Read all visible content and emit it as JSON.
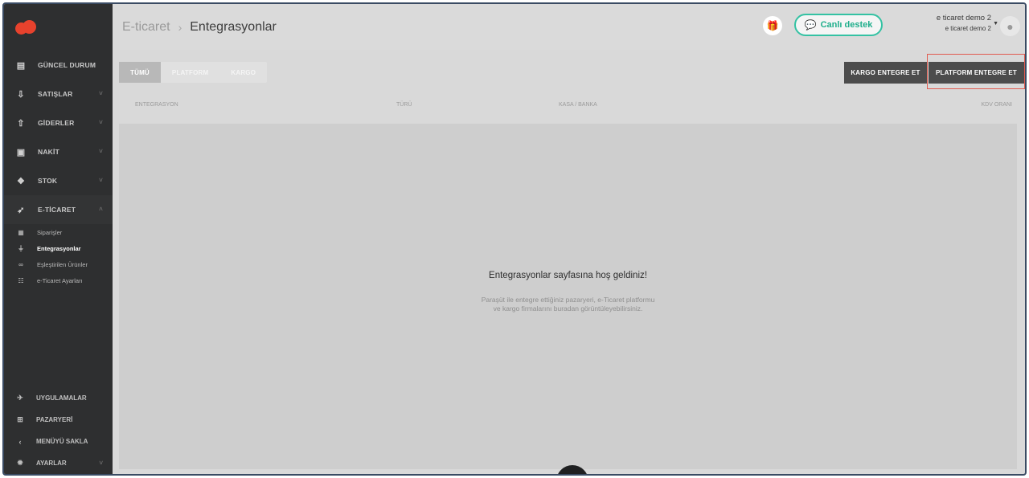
{
  "breadcrumb": {
    "parent": "E-ticaret",
    "separator": "›",
    "current": "Entegrasyonlar"
  },
  "support": {
    "label": "Canlı destek",
    "icon": "chat-bubbles-icon"
  },
  "user": {
    "name": "e ticaret demo 2",
    "company": "e ticaret demo 2"
  },
  "sidebar": {
    "items": [
      {
        "label": "GÜNCEL DURUM",
        "icon": "dashboard-icon"
      },
      {
        "label": "SATIŞLAR",
        "icon": "sales-icon",
        "chevron": "˅"
      },
      {
        "label": "GİDERLER",
        "icon": "expenses-icon",
        "chevron": "˅"
      },
      {
        "label": "NAKİT",
        "icon": "cash-icon",
        "chevron": "˅"
      },
      {
        "label": "STOK",
        "icon": "stock-icon",
        "chevron": "˅"
      },
      {
        "label": "E-TİCARET",
        "icon": "rocket-icon",
        "chevron": "˄"
      }
    ],
    "subitems": [
      {
        "label": "Siparişler",
        "icon": "orders-icon"
      },
      {
        "label": "Entegrasyonlar",
        "icon": "plug-icon",
        "active": true
      },
      {
        "label": "Eşleştirilen Ürünler",
        "icon": "link-icon"
      },
      {
        "label": "e-Ticaret Ayarları",
        "icon": "settings-sliders-icon"
      }
    ],
    "bottom": [
      {
        "label": "UYGULAMALAR",
        "icon": "apps-icon"
      },
      {
        "label": "PAZARYERİ",
        "icon": "cart-icon"
      },
      {
        "label": "MENÜYÜ SAKLA",
        "icon": "collapse-icon"
      },
      {
        "label": "AYARLAR",
        "icon": "gear-icon",
        "chevron": "˅"
      }
    ]
  },
  "tabs": [
    {
      "label": "TÜMÜ",
      "active": true
    },
    {
      "label": "PLATFORM"
    },
    {
      "label": "KARGO"
    }
  ],
  "actions": {
    "cargo": "KARGO ENTEGRE ET",
    "platform": "PLATFORM ENTEGRE ET"
  },
  "table": {
    "headers": [
      "ENTEGRASYON",
      "TÜRÜ",
      "KASA / BANKA",
      "KDV ORANI"
    ]
  },
  "empty_state": {
    "title": "Entegrasyonlar sayfasına hoş geldiniz!",
    "line1": "Paraşüt ile entegre ettiğiniz pazaryeri, e-Ticaret platformu",
    "line2": "ve kargo firmalarını buradan görüntüleyebilirsiniz."
  },
  "colors": {
    "accent": "#34c2a3",
    "brand": "#e7422d",
    "sidebar": "#2e2f30",
    "highlight": "#e05a4f"
  }
}
